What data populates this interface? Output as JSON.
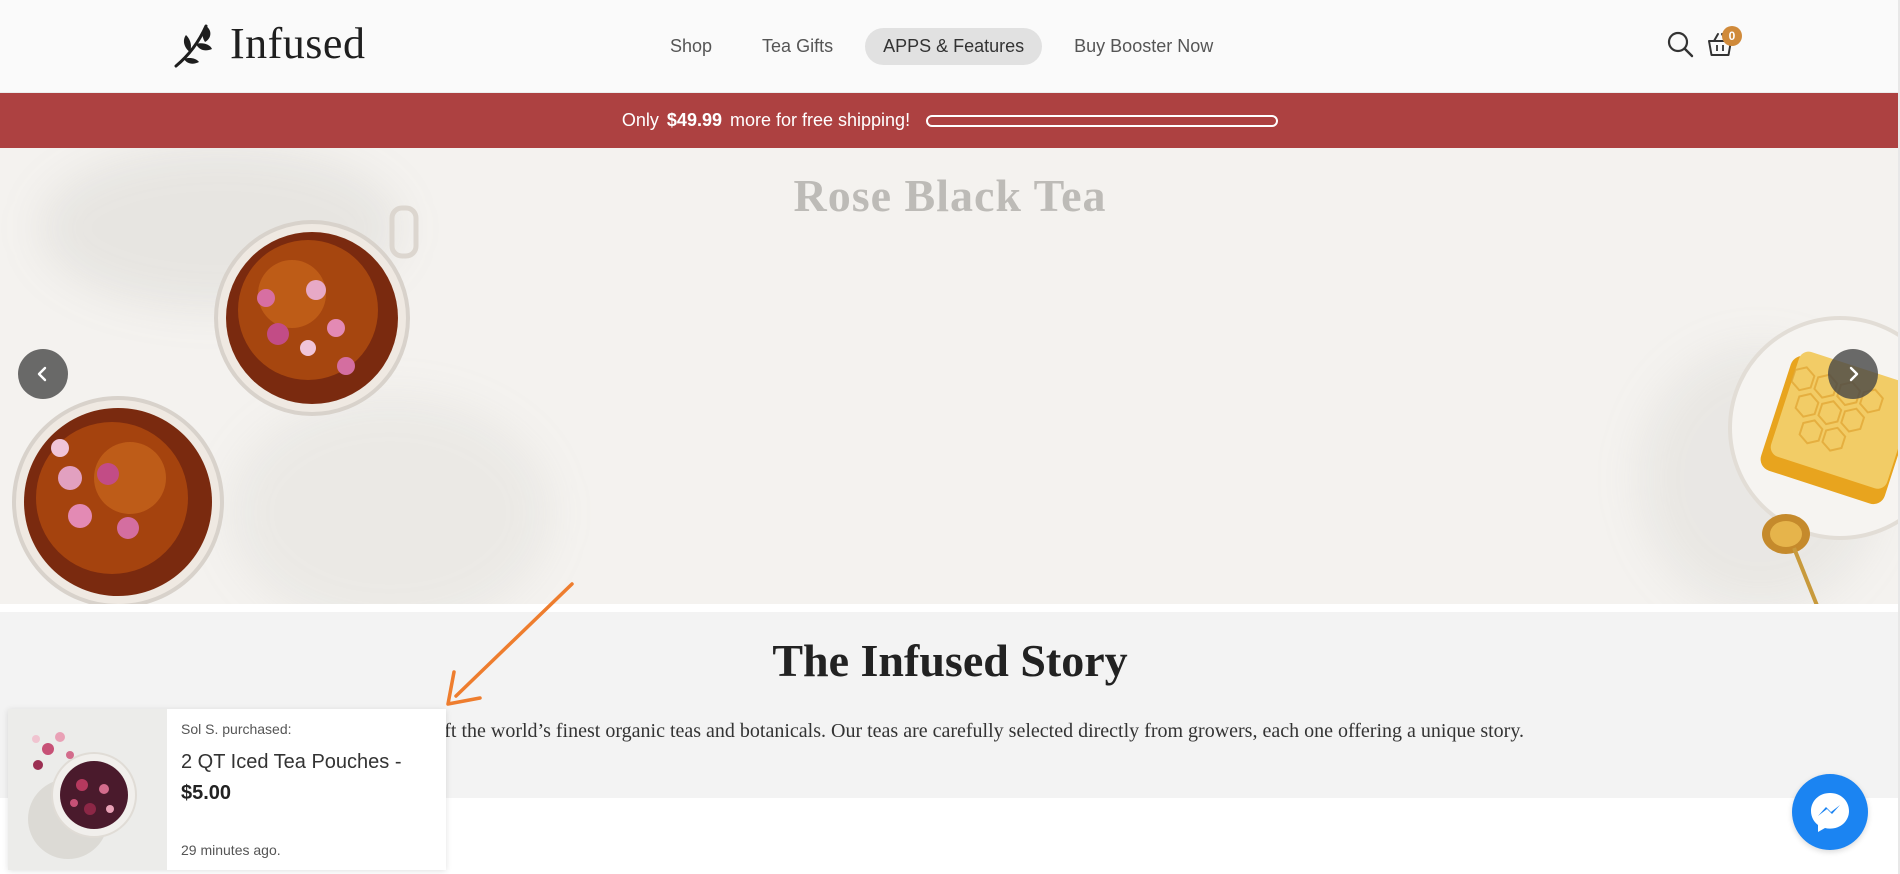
{
  "brand": {
    "name": "Infused",
    "logo_icon": "leaf-branch-icon"
  },
  "nav": {
    "items": [
      {
        "label": "Shop",
        "active": false
      },
      {
        "label": "Tea Gifts",
        "active": false
      },
      {
        "label": "APPS & Features",
        "active": true
      },
      {
        "label": "Buy Booster Now",
        "active": false
      }
    ]
  },
  "header_icons": {
    "search": "search-icon",
    "cart": "basket-icon",
    "cart_count": "0"
  },
  "shipping": {
    "prefix": "Only",
    "amount": "$49.99",
    "suffix": "more for free shipping!",
    "progress": 0.0
  },
  "hero": {
    "title": "Rose Black Tea",
    "prev_icon": "chevron-left-icon",
    "next_icon": "chevron-right-icon"
  },
  "story": {
    "title": "The Infused Story",
    "text": "stom craft the world’s finest organic teas and botanicals. Our teas are carefully selected directly from growers, each one offering a unique story."
  },
  "popup": {
    "buyer": "Sol S. purchased:",
    "product": "2 QT Iced Tea Pouches -",
    "price": "$5.00",
    "time": "29 minutes ago."
  },
  "chat": {
    "icon": "messenger-icon"
  },
  "colors": {
    "shipping_bar": "#ad4141",
    "cart_badge": "#d08a3a",
    "messenger": "#1b84f2",
    "annotation_arrow": "#ee7d2e"
  }
}
